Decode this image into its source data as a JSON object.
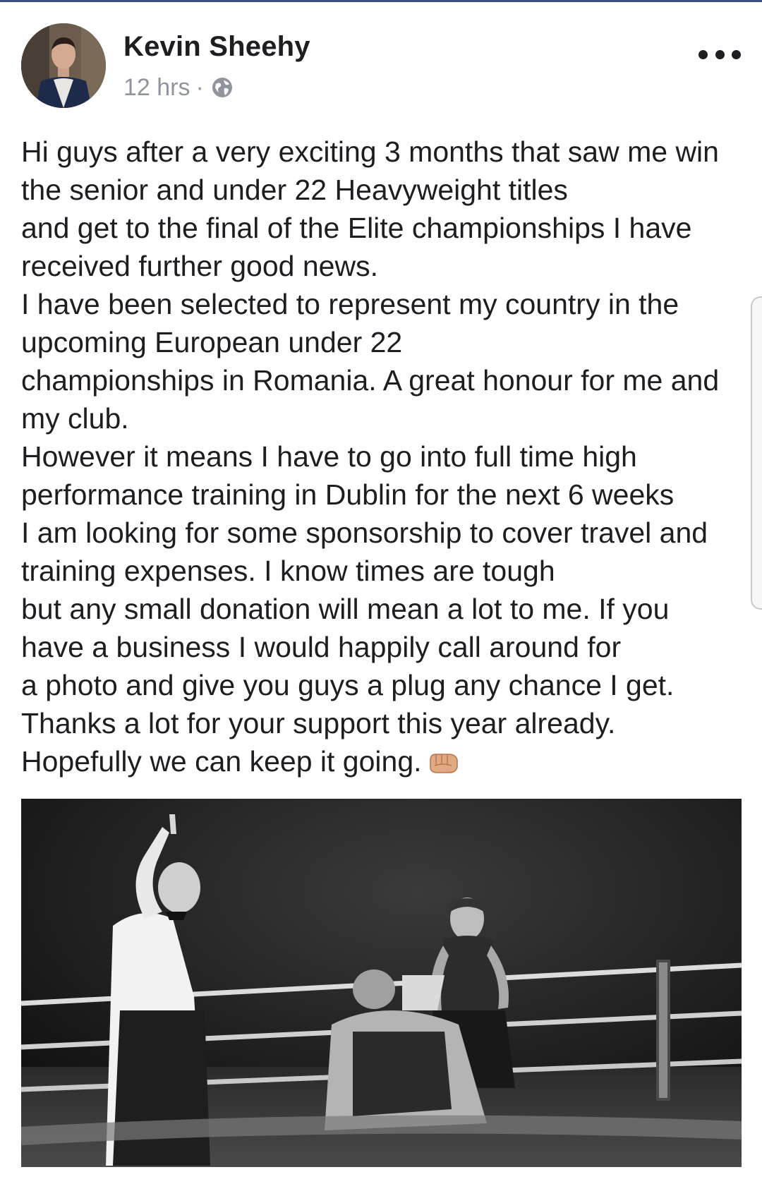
{
  "post": {
    "author": "Kevin Sheehy",
    "time": "12 hrs",
    "separator": "·",
    "privacy_icon": "globe-icon",
    "more_icon": "more-options-icon",
    "body_lines": [
      "Hi guys after a very exciting 3 months that saw me win",
      "the senior and under 22 Heavyweight titles",
      "and get to the final of the Elite championships I have",
      "received further good news.",
      "I have been selected to represent my country in the",
      "upcoming European under 22",
      "championships in Romania. A great honour for me and",
      "my club.",
      "However it means I have to go into full time high",
      "performance training in Dublin for the next 6 weeks",
      "I am looking for some sponsorship to cover travel and",
      "training expenses. I know times are tough",
      "but any small donation will mean a lot to me. If you",
      "have a business I would happily call around for",
      "a photo and give you guys a plug any chance I get.",
      "Thanks a lot for your support this year already.",
      "Hopefully we can keep it going."
    ],
    "trailing_emoji": "fist-bump-icon",
    "photo": "boxing-ring-photo"
  },
  "colors": {
    "text": "#1c1e21",
    "meta": "#90949c",
    "top_rule": "#3b5080"
  }
}
